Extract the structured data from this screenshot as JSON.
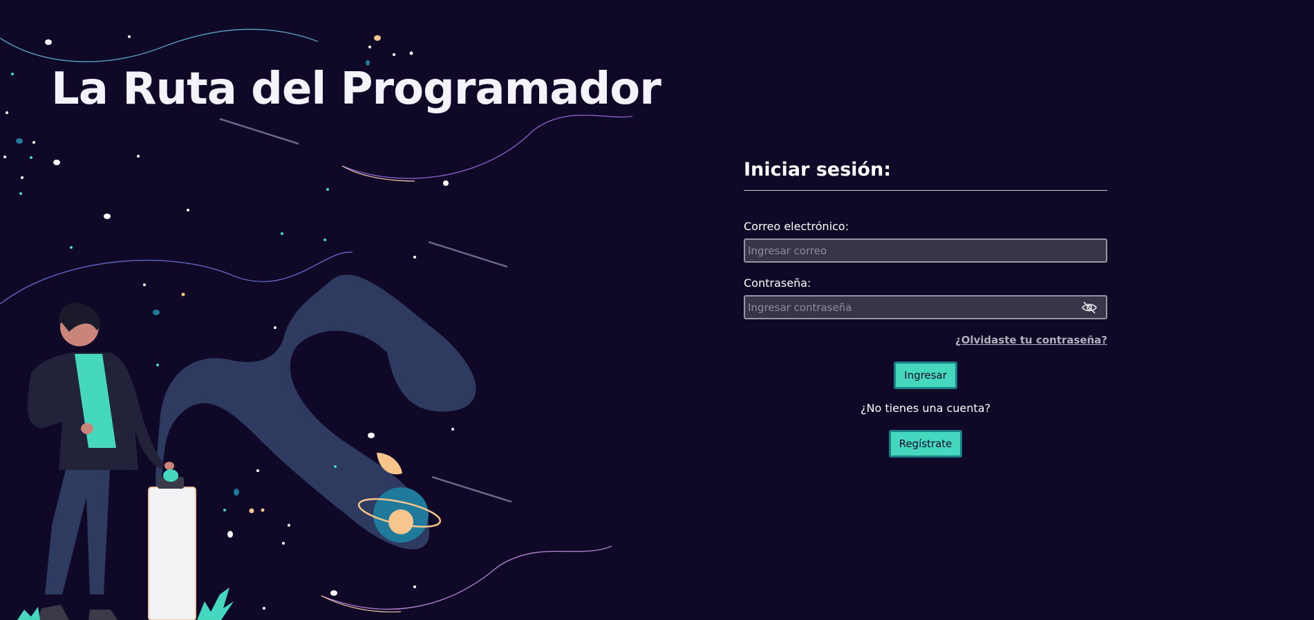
{
  "hero": {
    "title": "La Ruta del Programador"
  },
  "login": {
    "heading": "Iniciar sesión:",
    "email": {
      "label": "Correo electrónico:",
      "placeholder": "Ingresar correo",
      "value": ""
    },
    "password": {
      "label": "Contraseña:",
      "placeholder": "Ingresar contraseña",
      "value": "",
      "toggle_icon": "eye-slash-icon"
    },
    "forgot_link": "¿Olvidaste tu contraseña?",
    "submit_label": "Ingresar",
    "no_account_text": "¿No tienes una cuenta?",
    "register_label": "Regístrate"
  },
  "colors": {
    "background": "#0f0826",
    "accent": "#45d8bf",
    "accent_border": "#1b7f86",
    "input_bg": "#3a3448",
    "blob": "#2f3a60",
    "planet": "#1f7a9c",
    "peach": "#f8c58c"
  }
}
